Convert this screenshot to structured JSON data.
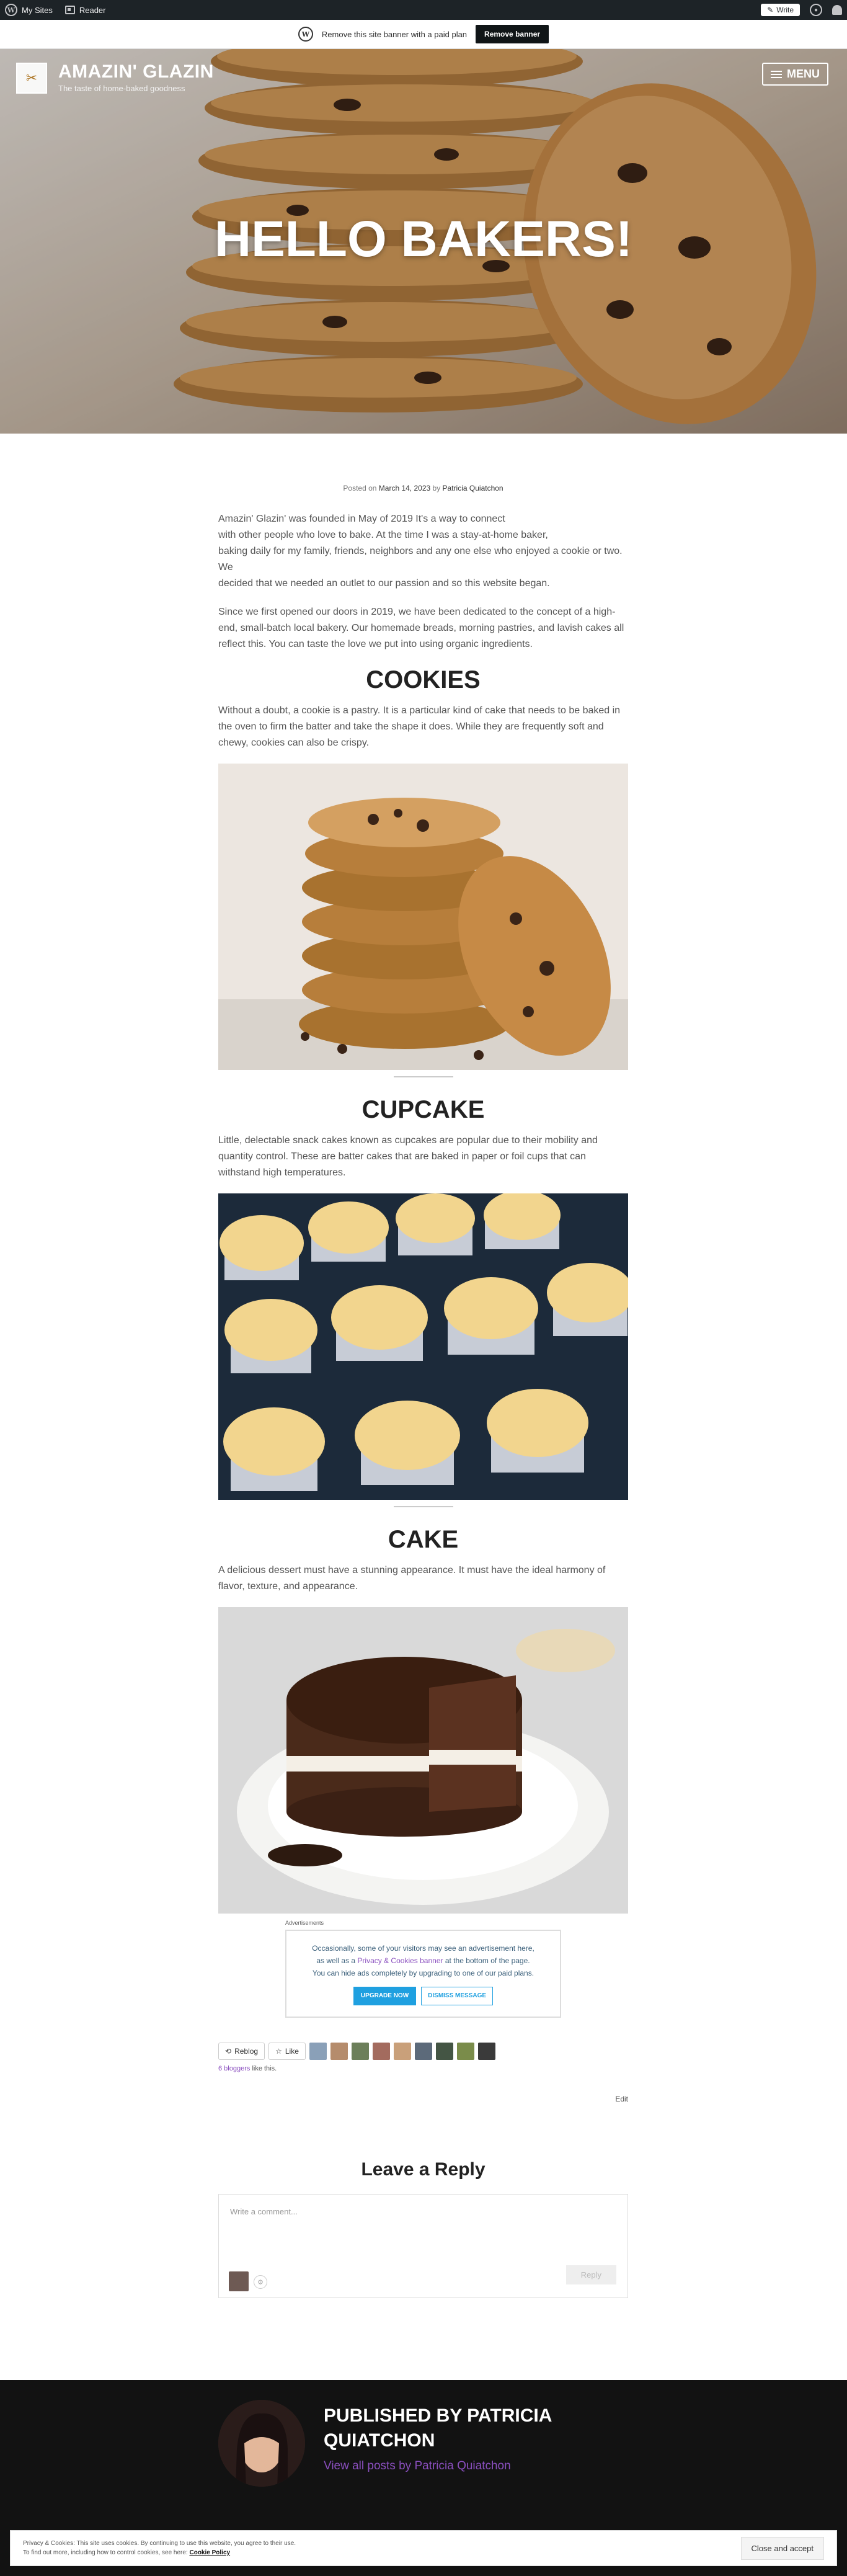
{
  "adminbar": {
    "mysites": "My Sites",
    "reader": "Reader",
    "write": "Write"
  },
  "banner": {
    "text": "Remove this site banner with a paid plan",
    "button": "Remove banner"
  },
  "header": {
    "title": "AMAZIN' GLAZIN",
    "tagline": "The taste of home-baked goodness",
    "menu": "MENU",
    "hero_heading": "HELLO BAKERS!"
  },
  "post": {
    "meta_prefix": "Posted on",
    "date": "March 14, 2023",
    "meta_by": "by",
    "author": "Patricia Quiatchon",
    "intro_lines": [
      "Amazin' Glazin' was founded in May of 2019 It's a way to connect",
      "with other people who love to bake. At the time I was a stay-at-home baker,",
      "baking daily for my family, friends, neighbors and any one else who enjoyed a cookie or two. We",
      "decided that we needed an outlet to our passion and so this website began."
    ],
    "para2": "Since we first opened our doors in 2019, we have been dedicated to the concept of a high-end, small-batch local bakery. Our homemade breads, morning pastries, and lavish cakes all reflect this. You can taste the love we put into using organic ingredients.",
    "sections": [
      {
        "heading": "COOKIES",
        "text": "Without a doubt, a cookie is a pastry. It is a particular kind of cake that needs to be baked in the oven to firm the batter and take the shape it does. While they are frequently soft and chewy, cookies can also be crispy."
      },
      {
        "heading": "CUPCAKE",
        "text": "Little, delectable snack cakes known as cupcakes are popular due to their mobility and quantity control. These are batter cakes that are baked in paper or foil cups that can withstand high temperatures."
      },
      {
        "heading": "CAKE",
        "text": "A delicious dessert must have a stunning appearance. It must have the ideal harmony of flavor, texture, and appearance."
      }
    ]
  },
  "ad": {
    "label": "Advertisements",
    "line1": "Occasionally, some of your visitors may see an advertisement here,",
    "line2_prefix": "as well as a",
    "line2_link": "Privacy & Cookies banner",
    "line2_suffix": "at the bottom of the page.",
    "line3": "You can hide ads completely by upgrading to one of our paid plans.",
    "upgrade": "UPGRADE NOW",
    "dismiss": "DISMISS MESSAGE"
  },
  "share": {
    "reblog": "Reblog",
    "like": "Like",
    "bloggers_count": "6 bloggers",
    "bloggers_suffix": "like this.",
    "edit": "Edit"
  },
  "comments": {
    "heading": "Leave a Reply",
    "placeholder": "Write a comment...",
    "reply": "Reply"
  },
  "author_box": {
    "name": "PUBLISHED BY PATRICIA QUIATCHON",
    "link": "View all posts by Patricia Quiatchon"
  },
  "cookie": {
    "line1": "Privacy & Cookies: This site uses cookies. By continuing to use this website, you agree to their use.",
    "line2_prefix": "To find out more, including how to control cookies, see here:",
    "line2_link": "Cookie Policy",
    "button": "Close and accept"
  },
  "colors": {
    "accent": "#8a4fbf",
    "upgrade_blue": "#1fa0e0",
    "footer_bg": "#121212"
  }
}
